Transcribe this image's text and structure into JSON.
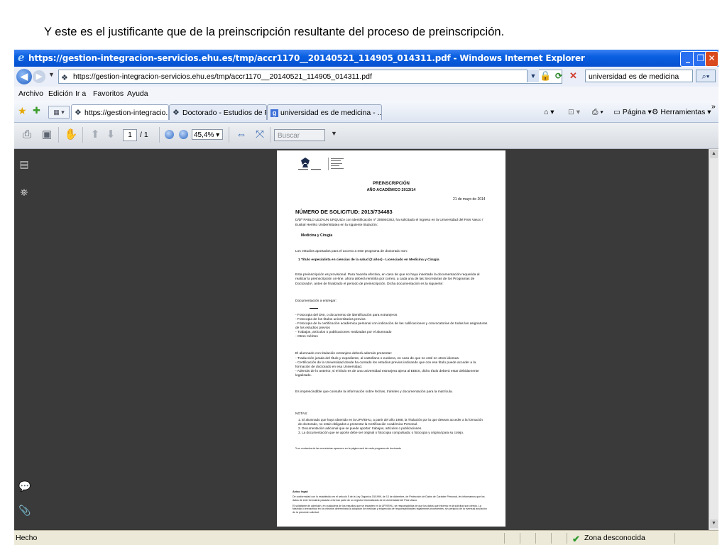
{
  "caption": "Y este es el justificante que de la preinscripción resultante del proceso de preinscripción.",
  "window": {
    "title": "https://gestion-integracion-servicios.ehu.es/tmp/accr1170__20140521_114905_014311.pdf - Windows Internet Explorer",
    "minimize": "_",
    "maximize": "❐",
    "close": "✕"
  },
  "address_bar": {
    "url": "https://gestion-integracion-servicios.ehu.es/tmp/accr1170__20140521_114905_014311.pdf",
    "search_value": "universidad es de medicina"
  },
  "menu": [
    "Archivo",
    "Edición",
    "Ir a",
    "Favoritos",
    "Ayuda"
  ],
  "tabs": [
    {
      "label": "https://gestion-integracio...",
      "close": "X"
    },
    {
      "label": "Doctorado - Estudios de Post..."
    },
    {
      "label": "universidad es de medicina - ..."
    }
  ],
  "command_bar": {
    "pagina": "Página",
    "herramientas": "Herramientas",
    "more": "»"
  },
  "pdf_toolbar": {
    "page_current": "1",
    "page_total": "/ 1",
    "zoom": "45,4%",
    "find_placeholder": "Buscar"
  },
  "document": {
    "heading": "PREINSCRIPCIÓN",
    "subheading": "AÑO ACADÉMICO 2013/14",
    "date": "21 de mayo de 2014",
    "request_number": "NÚMERO DE SOLICITUD: 2013/734483",
    "intro": "D/Dª PABLO LEZAUN URQUIZA con identificación nº 30694038J, ha solicitado el ingreso en la Universidad del País Vasco / Euskal Herriko Unibertsitatea en la siguiente titulación:",
    "degree": "Medicina y Cirugía",
    "studies_label": "Los estudios aportados para el acceso a este programa de doctorado son:",
    "studies_item": "1     Título especialista en ciencias de la salud (2 años) - Licenciado en Medicina y Cirugía",
    "provisional": "Esta preinscripción es provisional. Para hacerla efectiva, en caso de que no haya insertado la documentación requerida al realizar la preinscripción on-line, ahora deberá remitirla por correo, a cada una de las Secretarías de los Programas de Doctorado¹, antes de finalizado el periodo de preinscripción. Dicha documentación es la siguiente:",
    "docs_label": "Documentación a entregar:",
    "docs": [
      "- Fotocopia del DNI, o documento de identificación para extranjeros",
      "- Fotocopia de los títulos universitarios previos",
      "- Fotocopia de la certificación académica personal con indicación de las calificaciones y convocatorias de todas las asignaturas de los estudios previos",
      "- Trabajos, artículos o publicaciones realizadas por el alumnado",
      "- Otros méritos"
    ],
    "foreign_label": "El alumnado con titulación extranjera deberá además presentar:",
    "foreign": [
      "- Traducción jurada del título y expediente, al castellano o euskera, en caso de que no esté en otros idiomas.",
      "- Certificación de la Universidad donde ha cursado los estudios previos indicando que con ese título puede acceder a la formación de doctorado en esa Universidad.",
      "- Además de lo anterior, si el título es de una universidad extranjera ajena al EEES, dicho título deberá estar debidamente legalizado."
    ],
    "consult": "Es imprescindible que consulte la información sobre fechas, trámites y documentación para la matrícula.",
    "notes_label": "NOTAS:",
    "notes": [
      "1.  El alumnado que haya obtenido en la UPV/EHU, a partir del año 1988, la Titulación por la que desean acceder a la formación de doctorado, no están obligados a presentar la Certificación Académica Personal.",
      "2.  Documentación adicional que se puede aportar: trabajos, artículos o publicaciones.",
      "3.  La documentación que se aporte debe ser original o fotocopia compulsada; o fotocopia y original para su cotejo."
    ],
    "footnote": "¹Los contactos de las secretarías aparecen en la página web de cada programa de doctorado",
    "legal_label": "Aviso legal:",
    "legal": [
      "De conformidad con lo establecido en el artículo 5 de la Ley Orgánica 15/1999, de 13 de diciembre, de Protección de Datos de Carácter Personal, les informamos que los datos de este formulario pasarán a formar parte de un registro informatizado de la Universidad del País Vasco.",
      "El solicitante de admisión, en cualquiera de los estudios que se imparten en la UPV/EHU, se responsabiliza de que los datos que informa en la solicitud son ciertos. La falsedad o inexactitud en los mismos determinará la adopción de medidas y exigencias de responsabilidades legalmente procedentes, sin perjuicio de la eventual anulación de la presente solicitud."
    ]
  },
  "status_bar": {
    "left": "Hecho",
    "zone": "Zona desconocida"
  }
}
